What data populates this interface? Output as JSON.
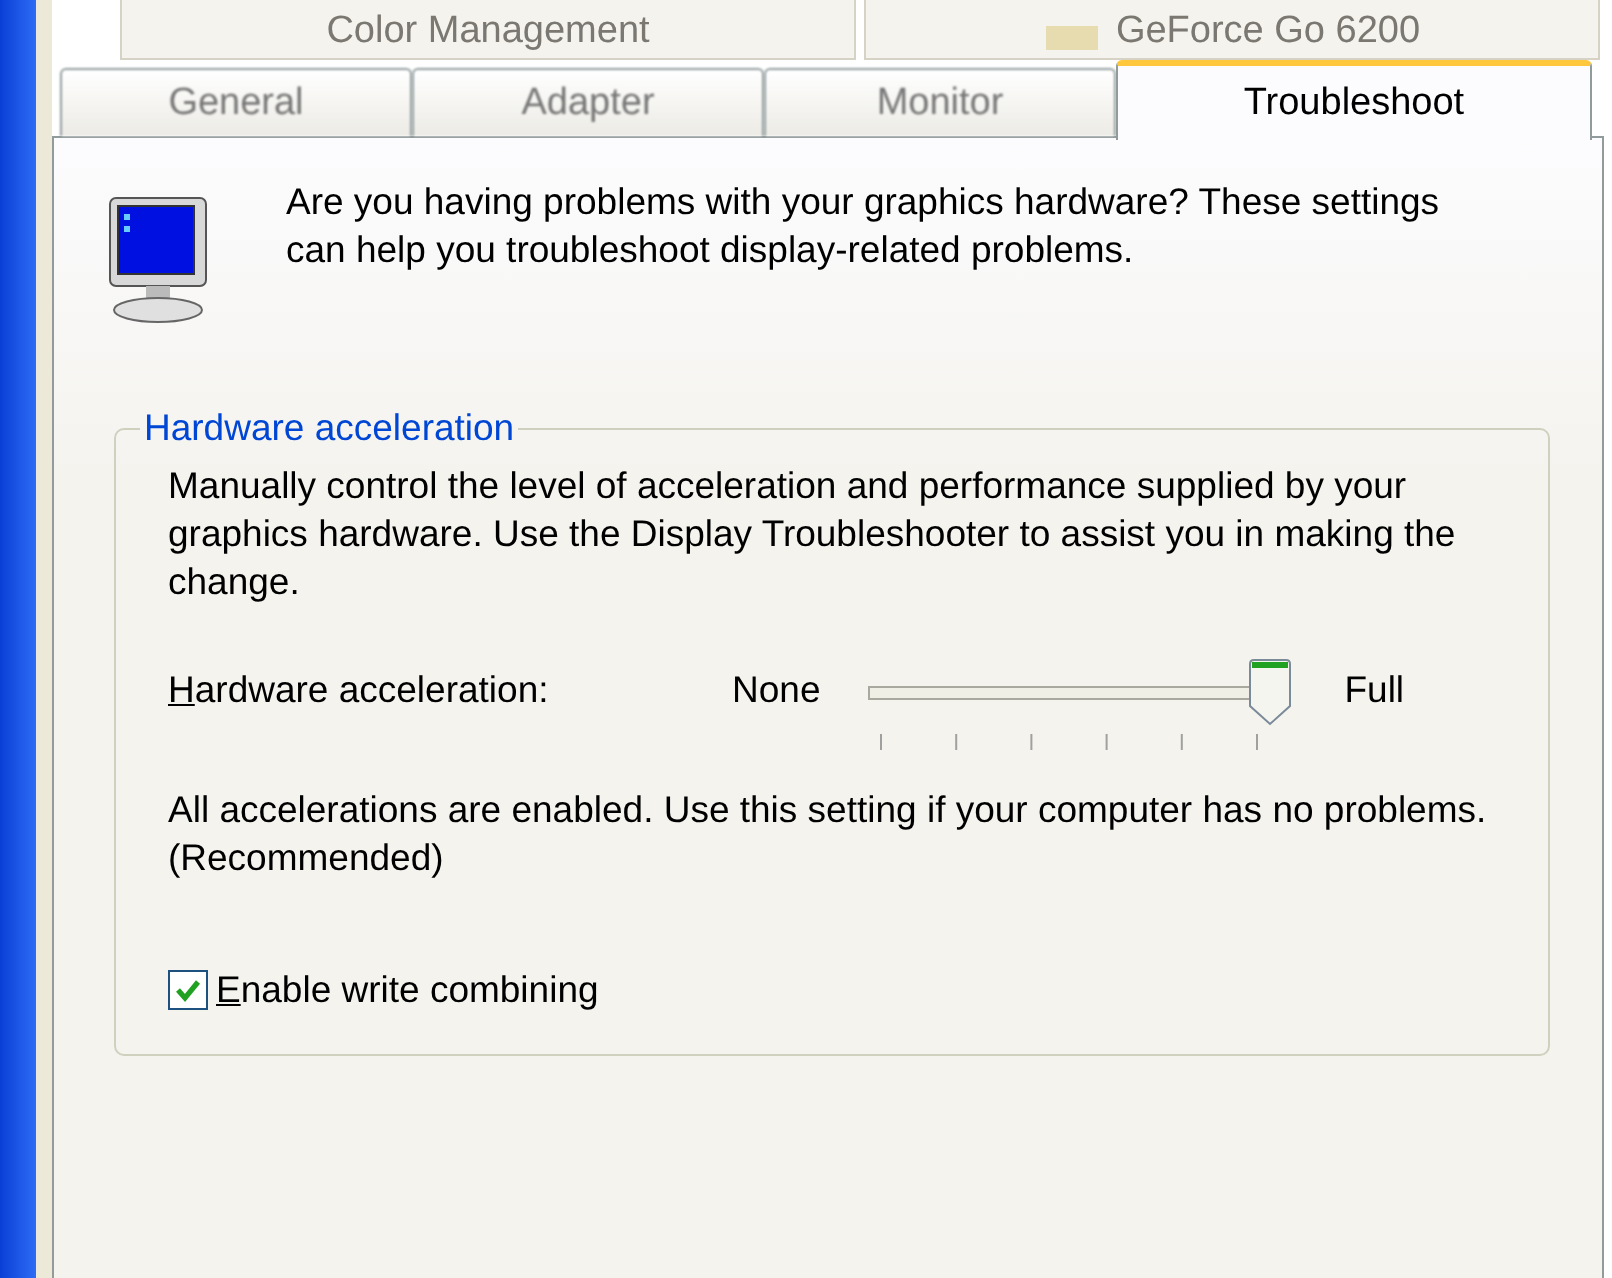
{
  "back_tabs": [
    {
      "label": "Color Management",
      "has_icon": false
    },
    {
      "label": "GeForce Go 6200",
      "has_icon": true
    }
  ],
  "tabs": [
    {
      "label": "General",
      "selected": false
    },
    {
      "label": "Adapter",
      "selected": false
    },
    {
      "label": "Monitor",
      "selected": false
    },
    {
      "label": "Troubleshoot",
      "selected": true
    }
  ],
  "intro": "Are you having problems with your graphics hardware? These settings can help you troubleshoot display-related problems.",
  "group": {
    "title": "Hardware acceleration",
    "description": "Manually control the level of acceleration and performance supplied by your graphics hardware. Use the Display Troubleshooter to assist you in making the change.",
    "slider": {
      "label": "Hardware acceleration:",
      "underline_first": true,
      "min_label": "None",
      "max_label": "Full",
      "level": 1
    },
    "status": "All accelerations are enabled. Use this setting if your computer has no problems. (Recommended)",
    "checkbox": {
      "label": "Enable write combining",
      "underline_first": true,
      "checked": true
    }
  }
}
